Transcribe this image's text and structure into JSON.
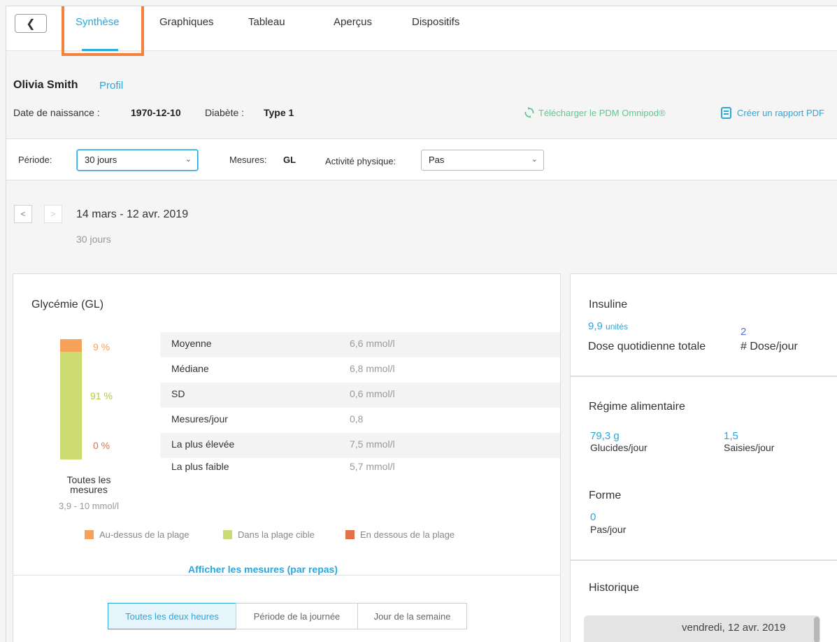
{
  "nav": {
    "tabs": [
      "Synthèse",
      "Graphiques",
      "Tableau",
      "Aperçus",
      "Dispositifs"
    ]
  },
  "patient": {
    "name": "Olivia Smith",
    "profile_link": "Profil",
    "dob_label": "Date de naissance :",
    "dob": "1970-12-10",
    "diabetes_label": "Diabète :",
    "diabetes_type": "Type 1"
  },
  "actions": {
    "download": "Télécharger le PDM Omnipod®",
    "report": "Créer un rapport PDF"
  },
  "filters": {
    "period_label": "Période:",
    "period_value": "30 jours",
    "measures_label": "Mesures:",
    "measures_value": "GL",
    "activity_label": "Activité physique:",
    "activity_value": "Pas"
  },
  "daterange": {
    "range": "14 mars - 12 avr. 2019",
    "sub": "30 jours"
  },
  "glycemia": {
    "title": "Glycémie (GL)",
    "above_pct": "9 %",
    "in_pct": "91 %",
    "below_pct": "0 %",
    "above_fraction": 0.09,
    "in_fraction": 0.91,
    "below_fraction": 0.0,
    "caption": "Toutes les mesures",
    "range": "3,9 - 10 mmol/l",
    "stats": [
      {
        "label": "Moyenne",
        "value": "6,6 mmol/l"
      },
      {
        "label": "Médiane",
        "value": "6,8 mmol/l"
      },
      {
        "label": "SD",
        "value": "0,6 mmol/l"
      },
      {
        "label": "Mesures/jour",
        "value": "0,8"
      },
      {
        "label": "La plus élevée",
        "value": "7,5 mmol/l"
      },
      {
        "label": "La plus faible",
        "value": "5,7 mmol/l"
      }
    ],
    "legend": {
      "above": "Au-dessus de la plage",
      "in": "Dans la plage cible",
      "below": "En dessous de la plage"
    },
    "show_link": "Afficher les mesures (par repas)",
    "segments": [
      "Toutes les deux heures",
      "Période de la journée",
      "Jour de la semaine"
    ]
  },
  "insulin": {
    "title": "Insuline",
    "total_value": "9,9",
    "total_units": "unités",
    "total_label": "Dose quotidienne totale",
    "doses_value": "2",
    "doses_label": "# Dose/jour"
  },
  "diet": {
    "title": "Régime alimentaire",
    "carbs_value": "79,3 g",
    "carbs_label": "Glucides/jour",
    "entries_value": "1,5",
    "entries_label": "Saisies/jour"
  },
  "fitness": {
    "title": "Forme",
    "steps_value": "0",
    "steps_label": "Pas/jour"
  },
  "history": {
    "title": "Historique",
    "date": "vendredi, 12 avr. 2019"
  },
  "colors": {
    "accent": "#2aa7dd",
    "above": "#f6a25a",
    "in_range": "#cddc72",
    "below": "#e2714a",
    "highlight": "#f5823a",
    "download": "#5fc98b"
  }
}
